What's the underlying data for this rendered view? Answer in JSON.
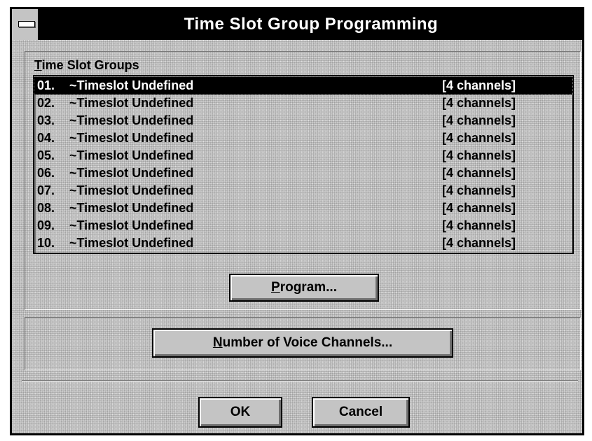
{
  "window": {
    "title": "Time Slot Group Programming"
  },
  "time_slot_groups": {
    "label": "Time Slot Groups",
    "label_mnemonic": "T",
    "label_rest": "ime Slot Groups",
    "selected_index": 0,
    "items": [
      {
        "number": "01.",
        "name": "~Timeslot Undefined",
        "channels": "[4 channels]"
      },
      {
        "number": "02.",
        "name": "~Timeslot Undefined",
        "channels": "[4 channels]"
      },
      {
        "number": "03.",
        "name": "~Timeslot Undefined",
        "channels": "[4 channels]"
      },
      {
        "number": "04.",
        "name": "~Timeslot Undefined",
        "channels": "[4 channels]"
      },
      {
        "number": "05.",
        "name": "~Timeslot Undefined",
        "channels": "[4 channels]"
      },
      {
        "number": "06.",
        "name": "~Timeslot Undefined",
        "channels": "[4 channels]"
      },
      {
        "number": "07.",
        "name": "~Timeslot Undefined",
        "channels": "[4 channels]"
      },
      {
        "number": "08.",
        "name": "~Timeslot Undefined",
        "channels": "[4 channels]"
      },
      {
        "number": "09.",
        "name": "~Timeslot Undefined",
        "channels": "[4 channels]"
      },
      {
        "number": "10.",
        "name": "~Timeslot Undefined",
        "channels": "[4 channels]"
      }
    ]
  },
  "buttons": {
    "program": {
      "label": "Program...",
      "mnemonic": "P",
      "rest": "rogram..."
    },
    "voice_channels": {
      "label": "Number of Voice Channels...",
      "mnemonic": "N",
      "rest": "umber of Voice Channels..."
    },
    "ok": {
      "label": "OK"
    },
    "cancel": {
      "label": "Cancel"
    }
  },
  "colors": {
    "title_bar": "#000000",
    "title_text": "#ffffff",
    "dialog_face": "#c8c8c8",
    "selection": "#000000"
  },
  "icons": {
    "system_menu": "system-menu-icon"
  }
}
